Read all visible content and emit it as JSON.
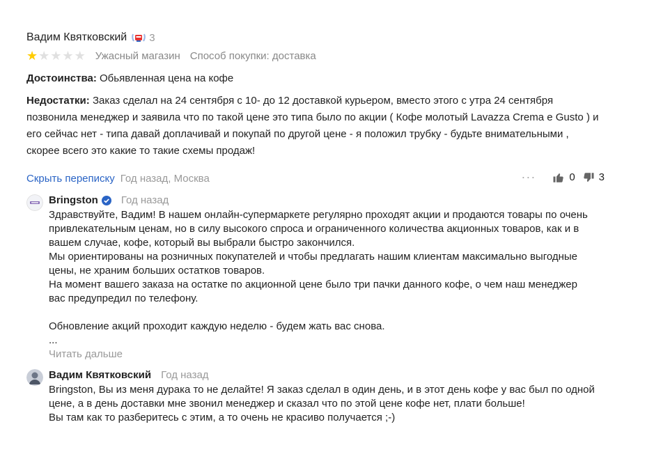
{
  "review": {
    "author": "Вадим Квятковский",
    "badge_count": "3",
    "rating": 1,
    "rating_max": 5,
    "rating_label": "Ужасный магазин",
    "purchase_method": "Способ покупки: доставка",
    "pros_label": "Достоинства:",
    "pros_text": "Обьявленная цена на кофе",
    "cons_label": "Недостатки:",
    "cons_text": "Заказ сделал на 24 сентября с 10- до 12 доставкой курьером, вместо этого с утра 24 сентября позвонила менеджер и заявила что по такой цене это типа было по акции ( Кофе молотый Lavazza Crema e Gusto ) и его сейчас нет - типа давай доплачивай и покупай по другой цене - я положил трубку - будьте внимательными , скорее всего это какие то такие схемы продаж!",
    "hide_thread": "Скрыть переписку",
    "date_location": "Год назад, Москва",
    "likes": "0",
    "dislikes": "3"
  },
  "replies": [
    {
      "name": "Bringston",
      "date": "Год назад",
      "lines": [
        "Здравствуйте, Вадим! В нашем онлайн-супермаркете регулярно проходят акции и продаются товары по очень",
        "привлекательным ценам, но в силу высокого спроса и ограниченного количества акционных товаров, как и в",
        "вашем случае, кофе, который вы выбрали быстро закончился.",
        "Мы ориентированы на розничных покупателей и чтобы предлагать нашим клиентам максимально выгодные",
        "цены, не храним больших остатков товаров.",
        "На момент вашего заказа на остатке по акционной цене было три пачки данного кофе, о чем наш менеджер",
        "вас предупредил по телефону.",
        "",
        "Обновление акций проходит каждую неделю - будем жать вас снова.",
        "..."
      ],
      "read_more": "Читать дальше"
    },
    {
      "name": "Вадим Квятковский",
      "date": "Год назад",
      "lines": [
        "Bringston, Вы из меня дурака то не делайте! Я заказ сделал в один день, и в этот день кофе у вас был по одной",
        "цене, а в день доставки мне звонил менеджер и сказал что по этой цене кофе нет, плати больше!",
        "Вы там как то разберитесь с этим, а то очень не красиво получается ;-)"
      ]
    }
  ],
  "colors": {
    "link": "#2a64c5",
    "star_active": "#ffcc00",
    "star_inactive": "#e0e0e0",
    "verified": "#2a64c5",
    "badge_red": "#e8322f"
  }
}
